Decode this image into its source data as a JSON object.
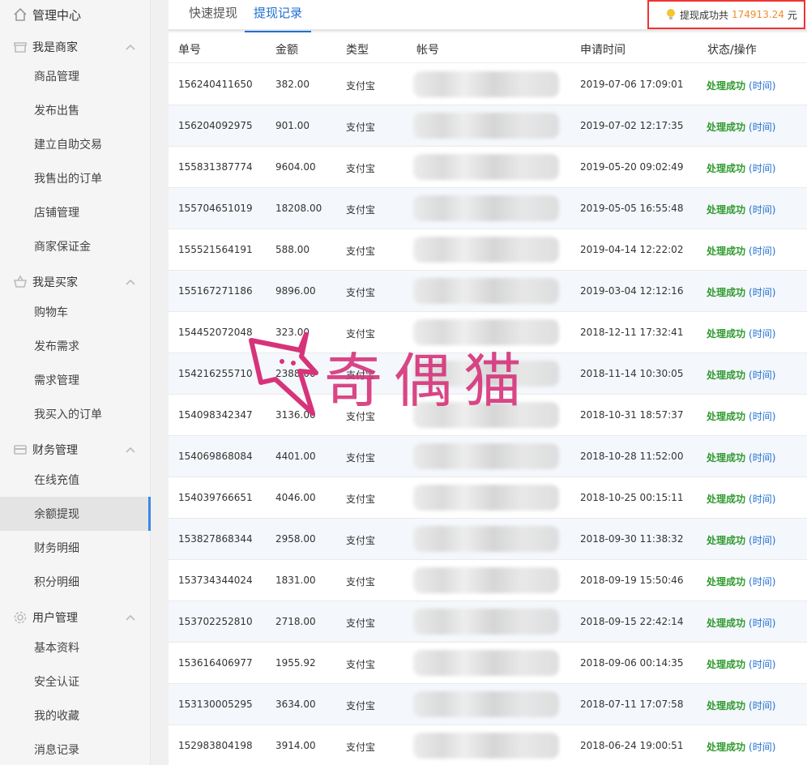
{
  "sidebar": {
    "title": "管理中心",
    "groups": [
      {
        "label": "我是商家",
        "icon": "store-icon",
        "items": [
          "商品管理",
          "发布出售",
          "建立自助交易",
          "我售出的订单",
          "店铺管理",
          "商家保证金"
        ]
      },
      {
        "label": "我是买家",
        "icon": "basket-icon",
        "items": [
          "购物车",
          "发布需求",
          "需求管理",
          "我买入的订单"
        ]
      },
      {
        "label": "财务管理",
        "icon": "card-icon",
        "items": [
          "在线充值",
          "余额提现",
          "财务明细",
          "积分明细"
        ]
      },
      {
        "label": "用户管理",
        "icon": "gear-icon",
        "items": [
          "基本资料",
          "安全认证",
          "我的收藏",
          "消息记录"
        ]
      }
    ],
    "active_item": "余额提现"
  },
  "tabs": [
    "快速提现",
    "提现记录"
  ],
  "active_tab": "提现记录",
  "summary": {
    "prefix": "提现成功共",
    "amount": "174913.24",
    "unit": "元"
  },
  "table": {
    "headers": [
      "单号",
      "金额",
      "类型",
      "帐号",
      "申请时间",
      "状态/操作"
    ],
    "status_label": "处理成功",
    "time_link": "(时间)",
    "rows": [
      {
        "id": "156240411650",
        "amount": "382.00",
        "type": "支付宝",
        "time": "2019-07-06 17:09:01"
      },
      {
        "id": "156204092975",
        "amount": "901.00",
        "type": "支付宝",
        "time": "2019-07-02 12:17:35"
      },
      {
        "id": "155831387774",
        "amount": "9604.00",
        "type": "支付宝",
        "time": "2019-05-20 09:02:49"
      },
      {
        "id": "155704651019",
        "amount": "18208.00",
        "type": "支付宝",
        "time": "2019-05-05 16:55:48"
      },
      {
        "id": "155521564191",
        "amount": "588.00",
        "type": "支付宝",
        "time": "2019-04-14 12:22:02"
      },
      {
        "id": "155167271186",
        "amount": "9896.00",
        "type": "支付宝",
        "time": "2019-03-04 12:12:16"
      },
      {
        "id": "154452072048",
        "amount": "323.00",
        "type": "支付宝",
        "time": "2018-12-11 17:32:41"
      },
      {
        "id": "154216255710",
        "amount": "2388.00",
        "type": "支付宝",
        "time": "2018-11-14 10:30:05"
      },
      {
        "id": "154098342347",
        "amount": "3136.00",
        "type": "支付宝",
        "time": "2018-10-31 18:57:37"
      },
      {
        "id": "154069868084",
        "amount": "4401.00",
        "type": "支付宝",
        "time": "2018-10-28 11:52:00"
      },
      {
        "id": "154039766651",
        "amount": "4046.00",
        "type": "支付宝",
        "time": "2018-10-25 00:15:11"
      },
      {
        "id": "153827868344",
        "amount": "2958.00",
        "type": "支付宝",
        "time": "2018-09-30 11:38:32"
      },
      {
        "id": "153734344024",
        "amount": "1831.00",
        "type": "支付宝",
        "time": "2018-09-19 15:50:46"
      },
      {
        "id": "153702252810",
        "amount": "2718.00",
        "type": "支付宝",
        "time": "2018-09-15 22:42:14"
      },
      {
        "id": "153616406977",
        "amount": "1955.92",
        "type": "支付宝",
        "time": "2018-09-06 00:14:35"
      },
      {
        "id": "153130005295",
        "amount": "3634.00",
        "type": "支付宝",
        "time": "2018-07-11 17:07:58"
      },
      {
        "id": "152983804198",
        "amount": "3914.00",
        "type": "支付宝",
        "time": "2018-06-24 19:00:51"
      }
    ]
  },
  "watermark": {
    "text": "奇偶猫",
    "color": "#d6337a"
  },
  "colors": {
    "accent": "#1f6fd0",
    "success": "#2f9a2f",
    "amount": "#f08c2f",
    "highlight_border": "#ee3333"
  }
}
